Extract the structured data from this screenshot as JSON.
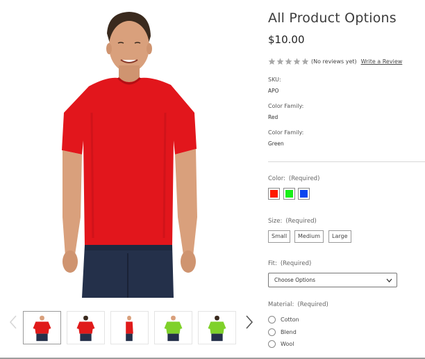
{
  "product": {
    "title": "All Product Options",
    "price": "$10.00",
    "rating": {
      "stars": 5,
      "filled": 0,
      "reviews_text": "(No reviews yet)",
      "write_review_label": "Write a Review"
    }
  },
  "specs": [
    {
      "label": "SKU:",
      "value": "APO"
    },
    {
      "label": "Color Family:",
      "value": "Red"
    },
    {
      "label": "Color Family:",
      "value": "Green"
    }
  ],
  "options": {
    "color": {
      "label": "Color:",
      "required": "(Required)",
      "swatches": [
        {
          "name": "Red",
          "hex": "#ff1a00"
        },
        {
          "name": "Green",
          "hex": "#18f018"
        },
        {
          "name": "Blue",
          "hex": "#0a46f0"
        }
      ]
    },
    "size": {
      "label": "Size:",
      "required": "(Required)",
      "values": [
        "Small",
        "Medium",
        "Large"
      ]
    },
    "fit": {
      "label": "Fit:",
      "required": "(Required)",
      "placeholder": "Choose Options"
    },
    "material": {
      "label": "Material:",
      "required": "(Required)",
      "values": [
        "Cotton",
        "Blend",
        "Wool"
      ]
    }
  },
  "gallery": {
    "thumbnails": [
      {
        "shirt_color": "#e01a1a",
        "view": "front"
      },
      {
        "shirt_color": "#e01a1a",
        "view": "back"
      },
      {
        "shirt_color": "#e01a1a",
        "view": "side"
      },
      {
        "shirt_color": "#7fd12a",
        "view": "front"
      },
      {
        "shirt_color": "#7fd12a",
        "view": "back"
      }
    ]
  },
  "colors": {
    "shirt_main": "#e2161c",
    "jeans": "#24304a",
    "skin": "#d9a07c",
    "hair": "#3a2a1e"
  }
}
